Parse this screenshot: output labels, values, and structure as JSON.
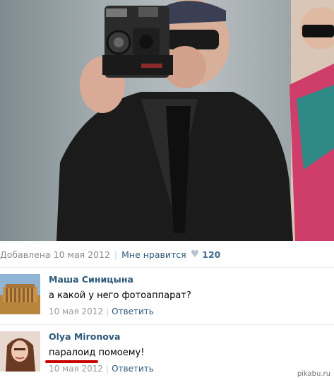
{
  "post": {
    "added_text": "Добавлена 10 мая 2012",
    "like_label": "Мне нравится",
    "like_count": "120",
    "heart_icon": "heart-icon"
  },
  "comments": [
    {
      "author": "Маша Синицына",
      "text": "а какой у него фотоаппарат?",
      "date": "10 мая 2012",
      "reply": "Ответить"
    },
    {
      "author": "Olya Mironova",
      "text_part1": "паралоид",
      "text_part2": " помоему!",
      "date": "10 мая 2012",
      "reply": "Ответить"
    }
  ],
  "watermark": "pikabu.ru",
  "colors": {
    "link": "#2b587a",
    "muted": "#999999",
    "highlight": "#cc0000"
  }
}
